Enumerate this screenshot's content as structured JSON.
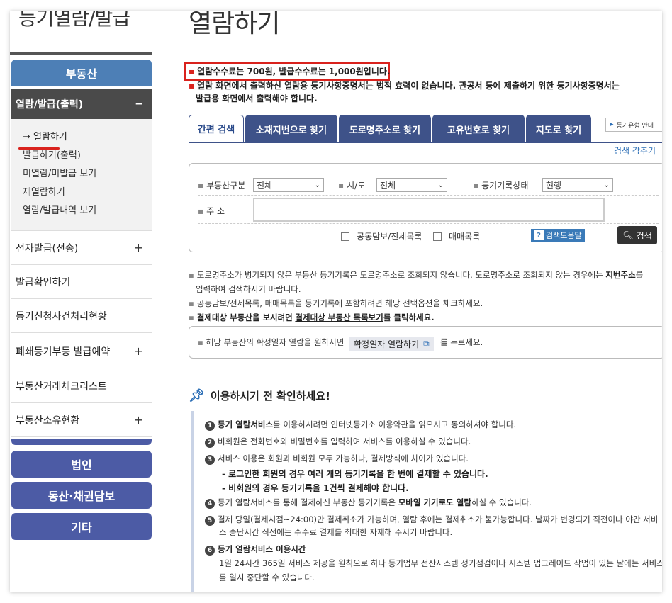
{
  "sidebar": {
    "title": "등기열람/발급",
    "category": "부동산",
    "section_open": "열람/발급(출력)",
    "section_toggle": "−",
    "submenu": [
      "→ 열람하기",
      "발급하기(출력)",
      "미열람/미발급 보기",
      "재열람하기",
      "열람/발급내역 보기"
    ],
    "items": [
      {
        "label": "전자발급(전송)",
        "expand": "+"
      },
      {
        "label": "발급확인하기",
        "expand": ""
      },
      {
        "label": "등기신청사건처리현황",
        "expand": ""
      },
      {
        "label": "폐쇄등기부등 발급예약",
        "expand": "+"
      },
      {
        "label": "부동산거래체크리스트",
        "expand": ""
      },
      {
        "label": "부동산소유현황",
        "expand": "+"
      }
    ],
    "bottom_buttons": [
      "법인",
      "동산·채권담보",
      "기타"
    ]
  },
  "main": {
    "title": "열람하기",
    "fee_notice": "열람수수료는 700원, 발급수수료는 1,000원입니다.",
    "warning_line1": "열람 화면에서 출력하신 열람용 등기사항증명서는 법적 효력이 없습니다. 관공서 등에 제출하기 위한 등기사항증명서는",
    "warning_line2": "발급용 화면에서 출력해야 합니다.",
    "tabs": [
      "간편 검색",
      "소재지번으로 찾기",
      "도로명주소로 찾기",
      "고유번호로 찾기",
      "지도로 찾기"
    ],
    "guide_button": "등기유형 안내",
    "fold_link": "검색 감추기",
    "search": {
      "type_label": "부동산구분",
      "type_value": "전체",
      "city_label": "시/도",
      "city_value": "전체",
      "status_label": "등기기록상태",
      "status_value": "현행",
      "address_label": "주 소",
      "address_value": "",
      "check1": "공동담보/전세목록",
      "check2": "매매목록",
      "help_button": "검색도움말",
      "help_q": "?",
      "search_button": "검색"
    },
    "info": {
      "line1a": "도로명주소가 병기되지 않은 부동산 등기기록은 도로명주소로 조회되지 않습니다. 도로명주소로 조회되지 않는 경우에는",
      "line1b": "지번주소",
      "line1c": "를",
      "line2": "입력하여 검색하시기 바랍니다.",
      "line3": "공동담보/전세목록, 매매목록을 등기기록에 포함하려면 해당 선택옵션을 체크하세요.",
      "line4a": "결제대상 부동산을 보시려면",
      "line4b": "결제대상 부동산 목록보기",
      "line4c": "를 클릭하세요."
    },
    "confirm": {
      "prefix": "해당 부동산의 확정일자 열람을 원하시면",
      "button": "확정일자 열람하기",
      "suffix": "를 누르세요."
    },
    "check_title": "이용하시기 전 확인하세요!",
    "checks": {
      "c1a": "등기 열람서비스",
      "c1b": "를 이용하시려면 인터넷등기소 이용약관을 읽으시고 동의하셔야 합니다.",
      "c2": "비회원은 전화번호와 비밀번호를 입력하여 서비스를 이용하실 수 있습니다.",
      "c3": "서비스 이용은 회원과 비회원 모두 가능하나, 결제방식에 차이가 있습니다.",
      "c3s1": "- 로그인한 회원의 경우 여러 개의 등기기록을 한 번에 결제할 수 있습니다.",
      "c3s2": "- 비회원의 경우 등기기록을 1건씩 결제해야 합니다.",
      "c4a": "등기 열람서비스를 통해 결제하신 부동산 등기기록은",
      "c4b": "모바일 기기로도 열람",
      "c4c": "하실 수 있습니다.",
      "c5a": "결제 당일(결제시점~24:00)만 결제취소가 가능하며, 열람 후에는 결제취소가 불가능합니다. 날짜가 변경되기 직전이나 야간 서비",
      "c5b": "스 중단시간 직전에는 수수료 결제를 최대한 자제해 주시기 바랍니다.",
      "c6": "등기 열람서비스 이용시간",
      "c6a": "1일 24시간 365일 서비스 제공을 원칙으로 하나 등기업무 전산시스템 정기점검이나 시스템 업그레이드 작업이 있는 날에는 서비스",
      "c6b": "를 일시 중단할 수 있습니다."
    },
    "numbers": [
      "1",
      "2",
      "3",
      "4",
      "5",
      "6"
    ]
  },
  "colors": {
    "category_blue": "#4d7fb6",
    "button_indigo": "#4c5ba5",
    "tab_navy": "#3e5289",
    "highlight_red": "#d9221d"
  }
}
